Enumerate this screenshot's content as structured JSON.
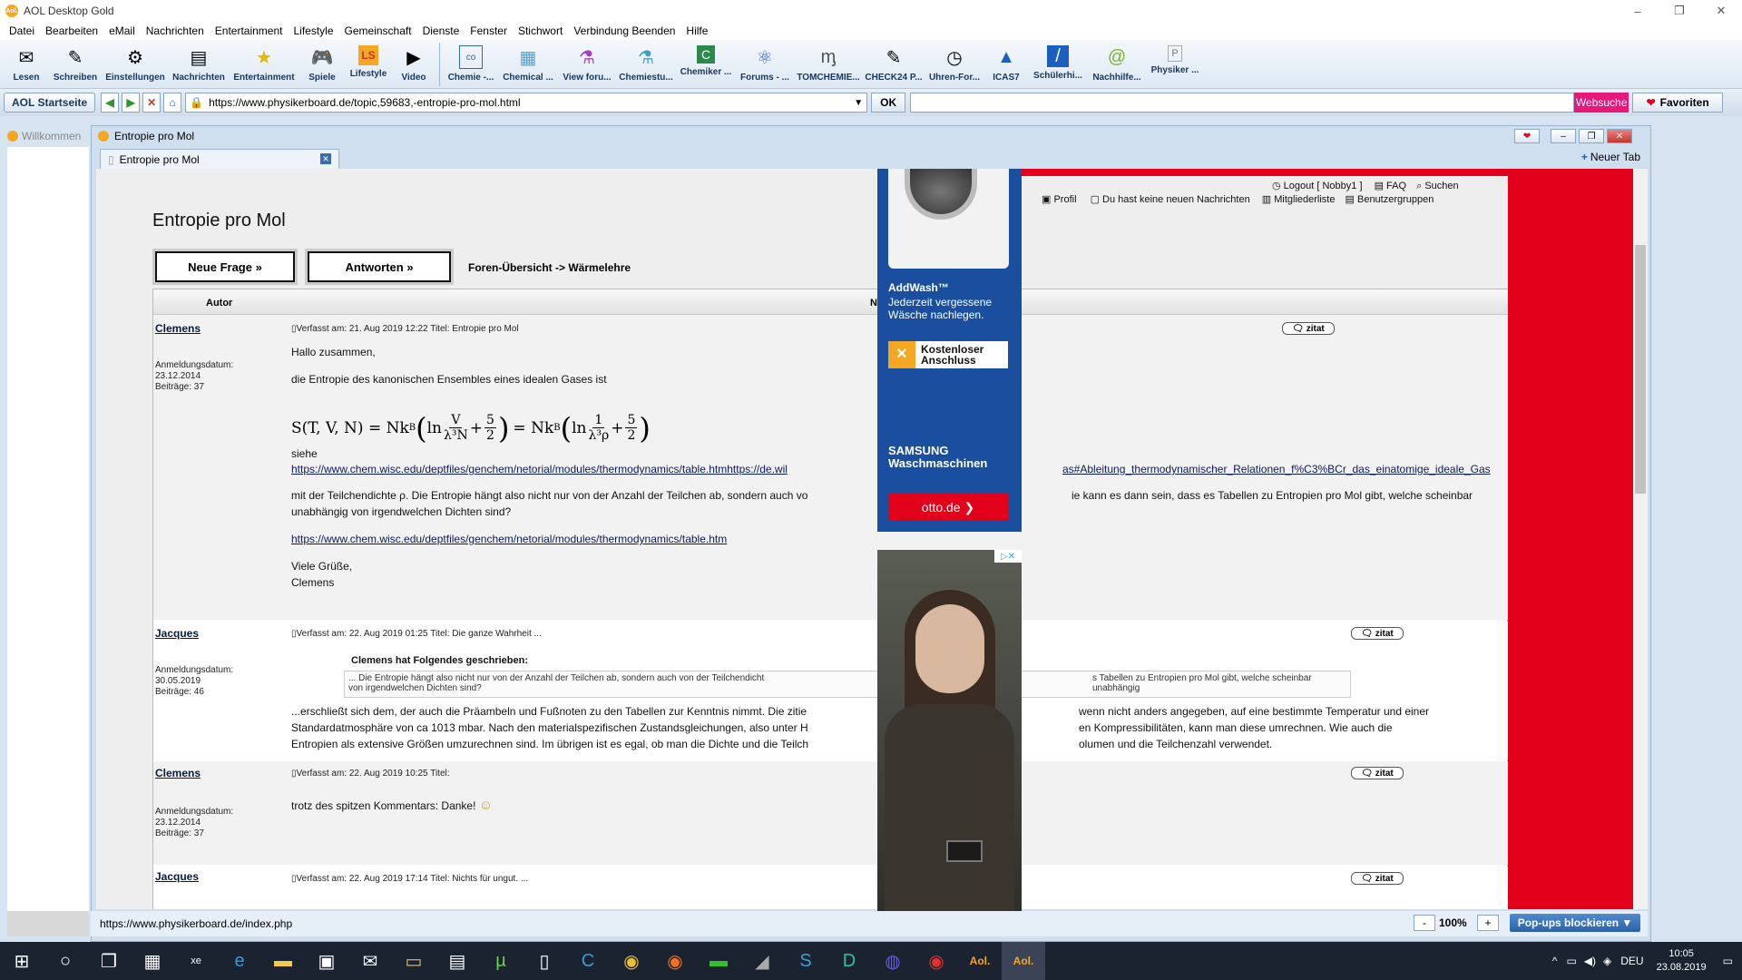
{
  "app": {
    "title": "AOL Desktop Gold"
  },
  "window_controls": [
    "–",
    "❐",
    "✕"
  ],
  "menu": [
    "Datei",
    "Bearbeiten",
    "eMail",
    "Nachrichten",
    "Entertainment",
    "Lifestyle",
    "Gemeinschaft",
    "Dienste",
    "Fenster",
    "Stichwort",
    "Verbindung Beenden",
    "Hilfe"
  ],
  "toolbar": {
    "main": [
      {
        "label": "Lesen",
        "icon": "✉"
      },
      {
        "label": "Schreiben",
        "icon": "✎"
      },
      {
        "label": "Einstellungen",
        "icon": "⚙"
      },
      {
        "label": "Nachrichten",
        "icon": "▤"
      },
      {
        "label": "Entertainment",
        "icon": "★"
      },
      {
        "label": "Spiele",
        "icon": "🎮"
      },
      {
        "label": "Lifestyle",
        "icon": "LS"
      },
      {
        "label": "Video",
        "icon": "▶"
      }
    ],
    "favorites": [
      {
        "label": "Chemie -...",
        "icon": "co"
      },
      {
        "label": "Chemical ...",
        "icon": "▦"
      },
      {
        "label": "View foru...",
        "icon": "⚗"
      },
      {
        "label": "Chemiestu...",
        "icon": "⚗"
      },
      {
        "label": "Chemiker ...",
        "icon": "C"
      },
      {
        "label": "Forums - ...",
        "icon": "⚛"
      },
      {
        "label": "TOMCHEMIE...",
        "icon": "ᶆ"
      },
      {
        "label": "CHECK24 P...",
        "icon": "✎"
      },
      {
        "label": "Uhren-For...",
        "icon": "◷"
      },
      {
        "label": "ICAS7",
        "icon": "▲"
      },
      {
        "label": "Schülerhi...",
        "icon": "/"
      },
      {
        "label": "Nachhilfe...",
        "icon": "@"
      },
      {
        "label": "Physiker ...",
        "icon": "P"
      }
    ]
  },
  "addressbar": {
    "start_label": "AOL Startseite",
    "url": "https://www.physikerboard.de/topic,59683,-entropie-pro-mol.html",
    "ok_label": "OK",
    "search_label": "Websuche",
    "favorites_label": "Favoriten"
  },
  "left_tab": {
    "label": "Willkommen"
  },
  "window": {
    "title": "Entropie pro Mol",
    "tab_label": "Entropie pro Mol",
    "new_tab": "Neuer Tab"
  },
  "forum": {
    "links_row1": [
      "Logout [ Nobby1 ]",
      "FAQ",
      "Suchen"
    ],
    "links_row2": [
      "Profil",
      "Du hast keine neuen Nachrichten",
      "Mitgliederliste",
      "Benutzergruppen"
    ],
    "title": "Entropie pro Mol",
    "btn_new": "Neue Frage »",
    "btn_reply": "Antworten »",
    "breadcrumb": "Foren-Übersicht -> Wärmelehre",
    "col_author": "Autor",
    "col_message": "N",
    "zitat": "zitat",
    "posts": [
      {
        "author": "Clemens",
        "meta": [
          "Anmeldungsdatum:",
          "23.12.2014",
          "Beiträge: 37"
        ],
        "info": "Verfasst am: 21. Aug 2019 12:22    Titel: Entropie pro Mol",
        "lines": [
          "Hallo zusammen,",
          "die Entropie des kanonischen Ensembles eines idealen Gases ist",
          "siehe",
          "https://www.chem.wisc.edu/deptfiles/genchem/netorial/modules/thermodynamics/table.htmhttps://de.wil",
          "as#Ableitung_thermodynamischer_Relationen_f%C3%BCr_das_einatomige_ideale_Gas",
          "mit der Teilchendichte ρ. Die Entropie hängt also nicht nur von der Anzahl der Teilchen ab, sondern auch vo",
          "ie kann es dann sein, dass es Tabellen zu Entropien pro Mol gibt, welche scheinbar",
          "unabhängig von irgendwelchen Dichten sind?",
          "https://www.chem.wisc.edu/deptfiles/genchem/netorial/modules/thermodynamics/table.htm",
          "Viele Grüße,",
          "Clemens"
        ],
        "formula": {
          "lhs": "S(T, V, N) = Nk",
          "sub": "B",
          "ln": "ln",
          "frac1_num": "V",
          "frac1_den": "λ³N",
          "plus": "+",
          "frac2_num": "5",
          "frac2_den": "2",
          "eq2": "= Nk",
          "frac3_num": "1",
          "frac3_den": "λ³ρ"
        }
      },
      {
        "author": "Jacques",
        "meta": [
          "Anmeldungsdatum:",
          "30.05.2019",
          "Beiträge: 46"
        ],
        "info": "Verfasst am: 22. Aug 2019 01:25    Titel: Die ganze Wahrheit ...",
        "quote_head": "Clemens hat Folgendes geschrieben:",
        "quote_lines": [
          "... Die Entropie hängt also nicht nur von der Anzahl der Teilchen ab, sondern auch von der Teilchendicht",
          "s Tabellen zu Entropien pro Mol gibt, welche scheinbar unabhängig",
          "von irgendwelchen Dichten sind?"
        ],
        "lines": [
          "...erschließt sich dem, der auch die Präambeln und Fußnoten zu den Tabellen zur Kenntnis nimmt. Die zitie",
          "wenn nicht anders angegeben, auf eine bestimmte Temperatur und einer",
          "Standardatmosphäre von ca 1013 mbar. Nach den materialspezifischen Zustandsgleichungen, also unter H",
          "en Kompressibilitäten, kann man diese umrechnen. Wie auch die",
          "Entropien als extensive Größen umzurechnen sind. Im übrigen ist es egal, ob man die Dichte und die Teilch",
          "olumen und die Teilchenzahl verwendet."
        ]
      },
      {
        "author": "Clemens",
        "meta": [
          "Anmeldungsdatum:",
          "23.12.2014",
          "Beiträge: 37"
        ],
        "info": "Verfasst am: 22. Aug 2019 10:25    Titel:",
        "lines": [
          "trotz des spitzen Kommentars: Danke!"
        ]
      },
      {
        "author": "Jacques",
        "info": "Verfasst am: 22. Aug 2019 17:14    Titel: Nichts für ungut. ..."
      }
    ]
  },
  "ads": {
    "washer": {
      "brand_line": "AddWash™",
      "desc": [
        "Jederzeit vergessene",
        "Wäsche nachlegen."
      ],
      "service": [
        "Kostenloser",
        "Anschluss"
      ],
      "maker": [
        "SAMSUNG",
        "Waschmaschinen"
      ],
      "cta": "otto.de  ❯"
    },
    "second": {
      "close": "▷✕"
    }
  },
  "status": {
    "url": "https://www.physikerboard.de/index.php",
    "zoom": "100%",
    "minus": "-",
    "plus": "+",
    "popup": "Pop-ups blockieren  ▼"
  },
  "taskbar": {
    "time": "10:05",
    "date": "23.08.2019",
    "lang": "DEU"
  }
}
